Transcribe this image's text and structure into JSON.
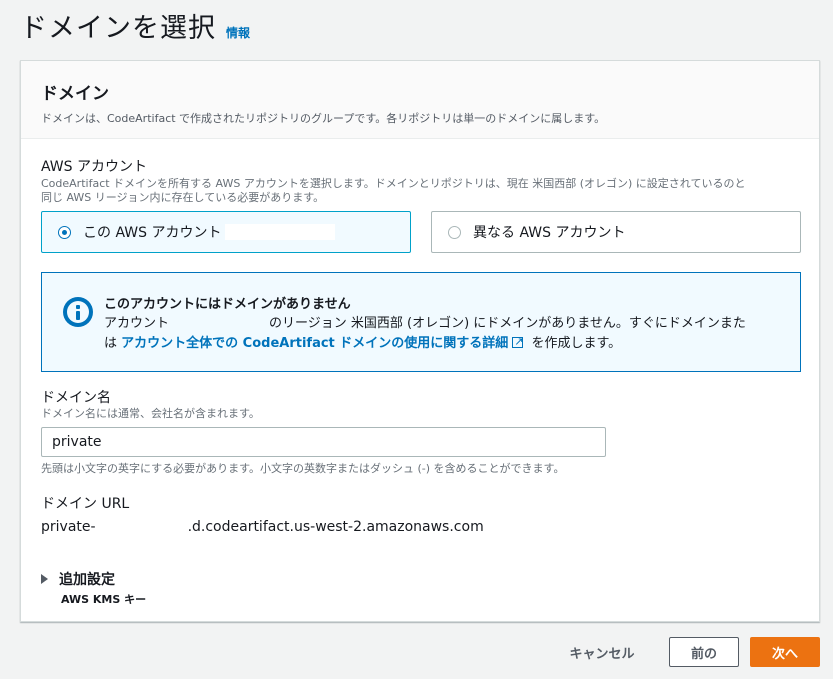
{
  "page": {
    "title": "ドメインを選択",
    "info_link": "情報"
  },
  "panel": {
    "title": "ドメイン",
    "description": "ドメインは、CodeArtifact で作成されたリポジトリのグループです。各リポジトリは単一のドメインに属します。"
  },
  "aws_account": {
    "label": "AWS アカウント",
    "description_line1": "CodeArtifact ドメインを所有する AWS アカウントを選択します。ドメインとリポジトリは、現在 米国西部 (オレゴン) に設定されているのと",
    "description_line2": "同じ AWS リージョン内に存在している必要があります。",
    "options": [
      {
        "label": "この AWS アカウント",
        "selected": true
      },
      {
        "label": "異なる AWS アカウント",
        "selected": false
      }
    ]
  },
  "alert": {
    "title": "このアカウントにはドメインがありません",
    "body_prefix": "アカウント",
    "body_middle": "のリージョン 米国西部 (オレゴン) にドメインがありません。すぐにドメインまた",
    "body_line2_prefix": "は",
    "link_text": "アカウント全体での CodeArtifact ドメインの使用に関する詳細",
    "body_suffix": "を作成します。",
    "icon": "info-icon",
    "color": "#0073bb"
  },
  "domain_name": {
    "label": "ドメイン名",
    "description": "ドメイン名には通常、会社名が含まれます。",
    "value": "private",
    "constraint": "先頭は小文字の英字にする必要があります。小文字の英数字またはダッシュ (-) を含めることができます。"
  },
  "domain_url": {
    "label": "ドメイン URL",
    "prefix": "private-",
    "suffix": ".d.codeartifact.us-west-2.amazonaws.com"
  },
  "additional": {
    "label": "追加設定",
    "sub": "AWS KMS キー"
  },
  "footer": {
    "cancel": "キャンセル",
    "previous": "前の",
    "next": "次へ",
    "primary_color": "#ec7211"
  }
}
